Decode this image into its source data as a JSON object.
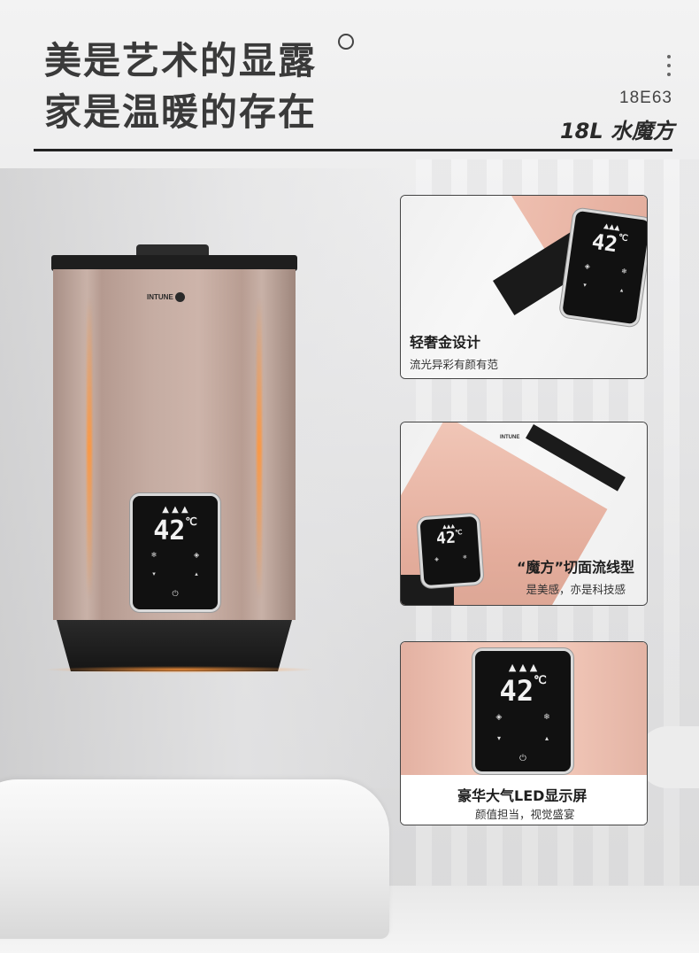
{
  "header": {
    "line1": "美是艺术的显露",
    "line2": "家是温暖的存在",
    "model_code": "18E63",
    "model_name": "18L 水魔方"
  },
  "product": {
    "brand_logo": "INTUNE",
    "display_temp": "42",
    "temp_unit": "℃"
  },
  "features": [
    {
      "title": "轻奢金设计",
      "subtitle": "流光异彩有颜有范"
    },
    {
      "title": "“魔方”切面流线型",
      "subtitle": "是美感，亦是科技感"
    },
    {
      "title": "豪华大气LED显示屏",
      "subtitle": "颜值担当，视觉盛宴"
    }
  ],
  "colors": {
    "heater_body": "#c5aca2",
    "accent_glow": "#ff9640",
    "text_dark": "#3a3a3a"
  },
  "icons": [
    "menu-dots-icon",
    "flame-icon",
    "power-icon",
    "fan-icon"
  ]
}
